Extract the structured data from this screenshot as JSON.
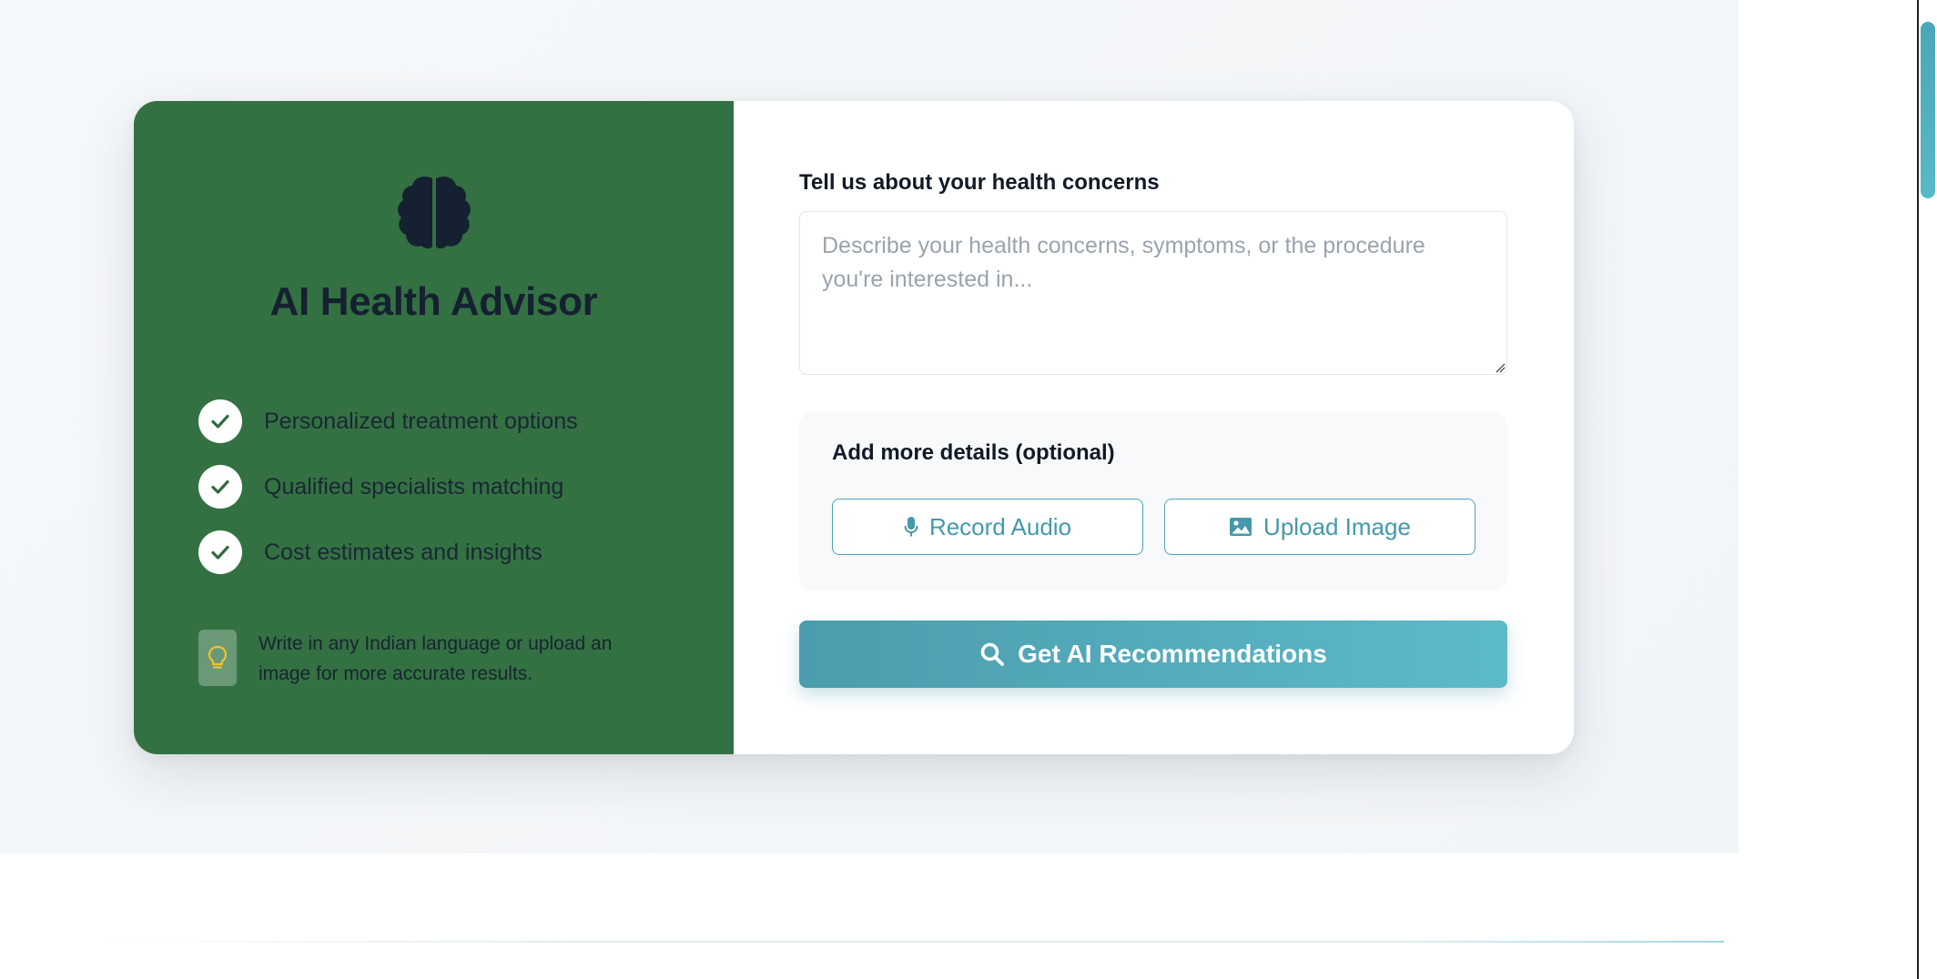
{
  "brand": {
    "title": "AI Health Advisor",
    "icon": "brain-icon"
  },
  "features": [
    {
      "label": "Personalized treatment options",
      "icon": "check-icon"
    },
    {
      "label": "Qualified specialists matching",
      "icon": "check-icon"
    },
    {
      "label": "Cost estimates and insights",
      "icon": "check-icon"
    }
  ],
  "tip": {
    "icon": "lightbulb-icon",
    "text": "Write in any Indian language or upload an image for more accurate results."
  },
  "form": {
    "concerns_label": "Tell us about your health concerns",
    "concerns_placeholder": "Describe your health concerns, symptoms, or the procedure you're interested in...",
    "concerns_value": ""
  },
  "details": {
    "title": "Add more details (optional)",
    "record_label": "Record Audio",
    "record_icon": "microphone-icon",
    "upload_label": "Upload Image",
    "upload_icon": "image-icon"
  },
  "submit": {
    "label": "Get AI Recommendations",
    "icon": "search-icon"
  },
  "colors": {
    "left_panel": "#337143",
    "accent": "#4fa3b3",
    "button_gradient_start": "#4b9cad",
    "button_gradient_end": "#5dbac9",
    "tip_icon": "#f2c230"
  }
}
